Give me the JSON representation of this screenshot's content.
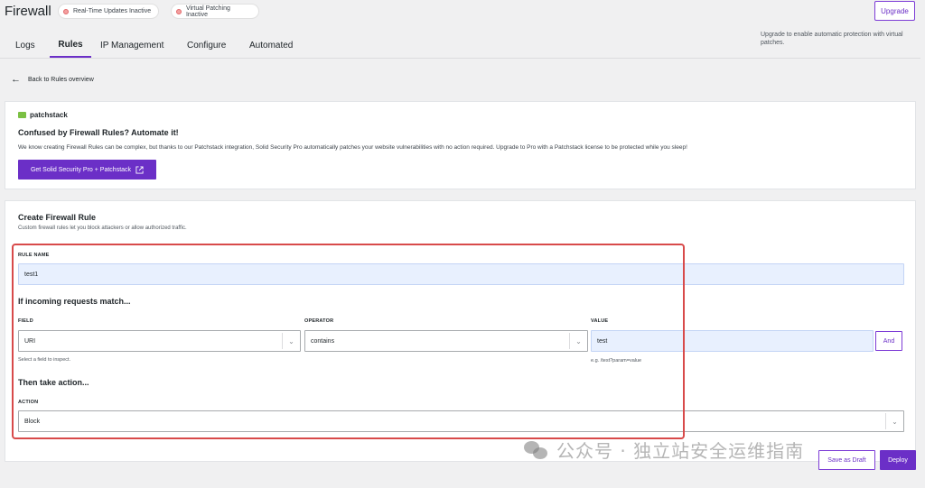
{
  "page": {
    "title": "Firewall"
  },
  "status": {
    "realtime": {
      "label": "Real-Time Updates Inactive"
    },
    "vpatch": {
      "label": "Virtual Patching Inactive"
    }
  },
  "upgrade": {
    "button_label": "Upgrade",
    "note": "Upgrade to enable automatic protection with virtual patches."
  },
  "tabs": [
    {
      "label": "Logs"
    },
    {
      "label": "Rules"
    },
    {
      "label": "IP Management"
    },
    {
      "label": "Configure"
    },
    {
      "label": "Automated"
    }
  ],
  "back_link": "Back to Rules overview",
  "promo": {
    "logo_text": "patchstack",
    "title": "Confused by Firewall Rules? Automate it!",
    "text": "We know creating Firewall Rules can be complex, but thanks to our Patchstack integration, Solid Security Pro automatically patches your website vulnerabilities with no action required. Upgrade to Pro with a Patchstack license to be protected while you sleep!",
    "button_label": "Get Solid Security Pro + Patchstack"
  },
  "rule_form": {
    "title": "Create Firewall Rule",
    "subtitle": "Custom firewall rules let you block attackers or allow authorized traffic.",
    "rule_name_label": "RULE NAME",
    "rule_name_value": "test1",
    "match_heading": "If incoming requests match...",
    "field_label": "FIELD",
    "field_value": "URI",
    "field_help": "Select a field to inspect.",
    "operator_label": "OPERATOR",
    "operator_value": "contains",
    "value_label": "VALUE",
    "value_value": "test",
    "value_help": "e.g. /test?param=value",
    "and_label": "And",
    "action_heading": "Then take action...",
    "action_label": "ACTION",
    "action_value": "Block"
  },
  "footer": {
    "save_draft_label": "Save as Draft",
    "deploy_label": "Deploy"
  },
  "watermark": "公众号 · 独立站安全运维指南",
  "colors": {
    "accent": "#6b2fc7",
    "highlight_border": "#d84a4a",
    "filled_input": "#e8f0fe"
  }
}
